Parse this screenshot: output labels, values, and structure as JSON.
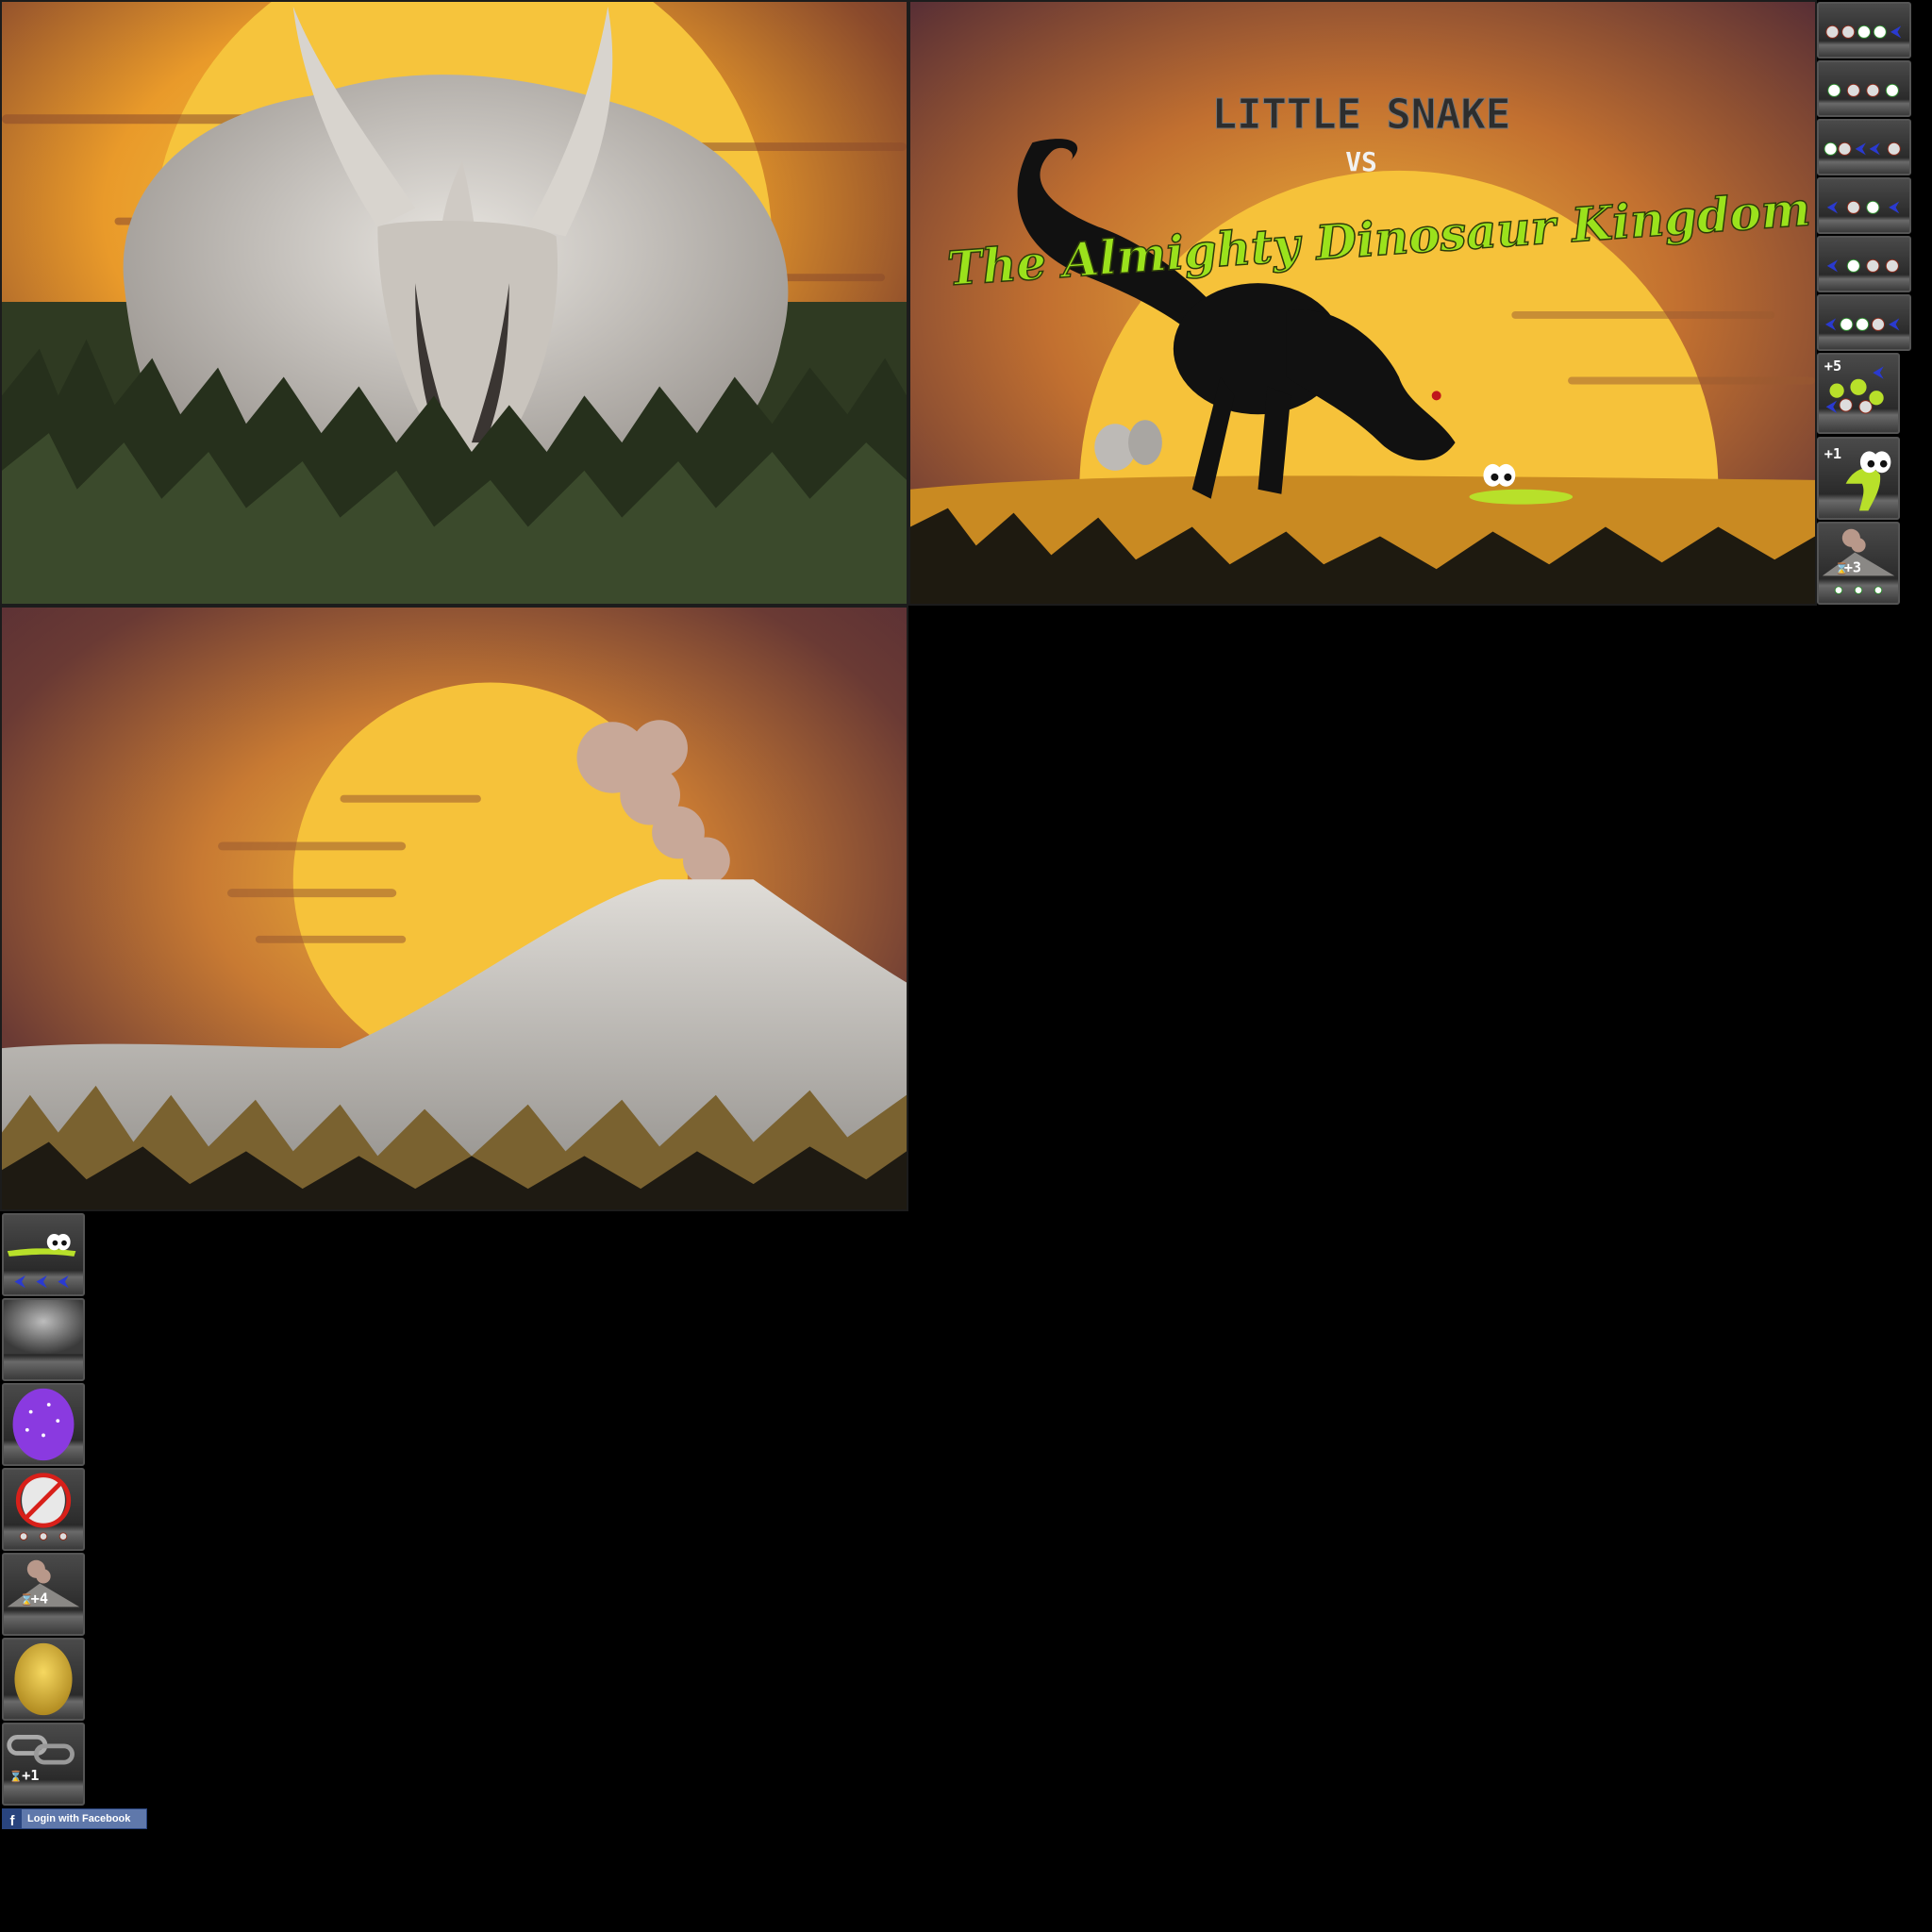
{
  "title_screen": {
    "line1": "LITTLE SNAKE",
    "line2": "VS",
    "line3": "The Almighty Dinosaur Kingdom"
  },
  "badges": {
    "plus5": "+5",
    "plus1": "+1",
    "plus3": "+3",
    "plus4": "+4",
    "plus1_chain": "+1"
  },
  "facebook": {
    "label": "Login with Facebook",
    "icon_letter": "f"
  },
  "colors": {
    "sky_dark": "#5a3035",
    "sun": "#f5c23a",
    "grass": "#2e3a24",
    "title_green": "#9be21c",
    "facebook_blue": "#5f78ab"
  },
  "sprites": [
    "triceratops-skull-background",
    "title-screen-trex",
    "volcano-background",
    "egg-row-1-icon",
    "egg-row-2-icon",
    "egg-row-3-icon",
    "egg-row-4-icon",
    "egg-row-5-icon",
    "egg-row-6-icon",
    "egg-bundle-plus5-icon",
    "snake-plus1-icon",
    "volcano-time-plus3-icon",
    "snake-speed-icon",
    "empty-slot-icon",
    "purple-egg-icon",
    "no-egg-icon",
    "volcano-time-plus4-icon",
    "golden-egg-icon",
    "chain-time-plus1-icon"
  ]
}
